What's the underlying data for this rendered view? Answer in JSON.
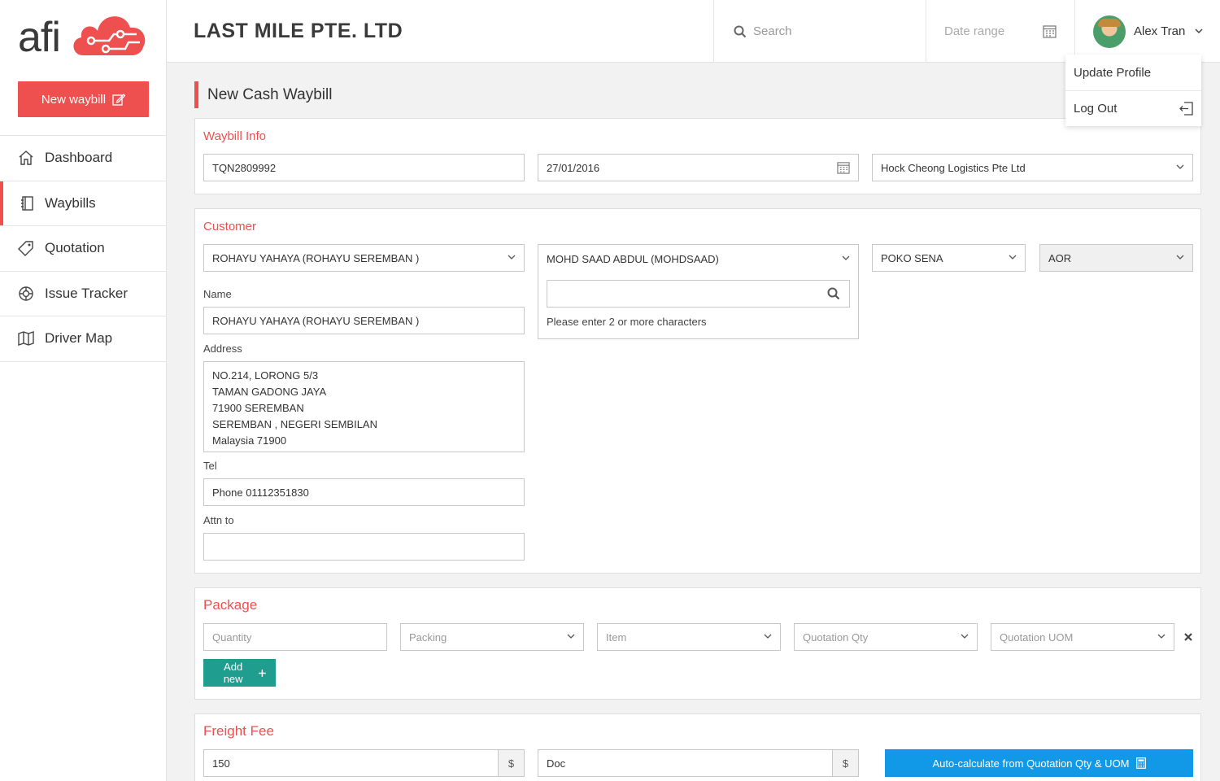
{
  "brand": {
    "logo_text": "afi",
    "new_waybill_label": "New waybill",
    "accent_color": "#ee4f4f"
  },
  "sidebar": {
    "items": [
      {
        "label": "Dashboard",
        "icon": "home-icon"
      },
      {
        "label": "Waybills",
        "icon": "notebook-icon",
        "active": true
      },
      {
        "label": "Quotation",
        "icon": "tag-icon"
      },
      {
        "label": "Issue Tracker",
        "icon": "lifebuoy-icon"
      },
      {
        "label": "Driver Map",
        "icon": "map-icon"
      }
    ]
  },
  "header": {
    "company": "LAST MILE PTE. LTD",
    "search_placeholder": "Search",
    "date_range_placeholder": "Date range",
    "user_name": "Alex Tran"
  },
  "user_menu": {
    "items": [
      "Update Profile",
      "Log Out"
    ]
  },
  "page": {
    "title": "New Cash Waybill"
  },
  "waybill_info": {
    "title": "Waybill Info",
    "waybill_no": "TQN2809992",
    "date": "27/01/2016",
    "company": "Hock Cheong Logistics Pte Ltd"
  },
  "customer": {
    "title": "Customer",
    "customer_select": "ROHAYU YAHAYA  (ROHAYU SEREMBAN )",
    "contact_select": "MOHD SAAD ABDUL  (MOHDSAAD)",
    "search_value": "",
    "search_hint": "Please enter 2 or more characters",
    "region_select": "POKO SENA",
    "type_select": "AOR",
    "name_label": "Name",
    "name_value": "ROHAYU YAHAYA  (ROHAYU SEREMBAN )",
    "address_label": "Address",
    "address_lines": [
      "NO.214, LORONG 5/3",
      "TAMAN GADONG JAYA",
      "71900 SEREMBAN",
      "SEREMBAN , NEGERI SEMBILAN",
      "Malaysia 71900"
    ],
    "tel_label": "Tel",
    "tel_value": "Phone 01112351830",
    "attn_label": "Attn to",
    "attn_value": ""
  },
  "package": {
    "title": "Package",
    "quantity_placeholder": "Quantity",
    "packing_placeholder": "Packing",
    "item_placeholder": "Item",
    "quotation_qty_placeholder": "Quotation Qty",
    "quotation_uom_placeholder": "Quotation UOM",
    "add_new_label": "Add new"
  },
  "freight": {
    "title": "Freight Fee",
    "fee_value": "150",
    "fee_currency": "$",
    "doc_value": "Doc",
    "doc_currency": "$",
    "auto_calc_label": "Auto-calculate from Quotation Qty & UOM"
  }
}
